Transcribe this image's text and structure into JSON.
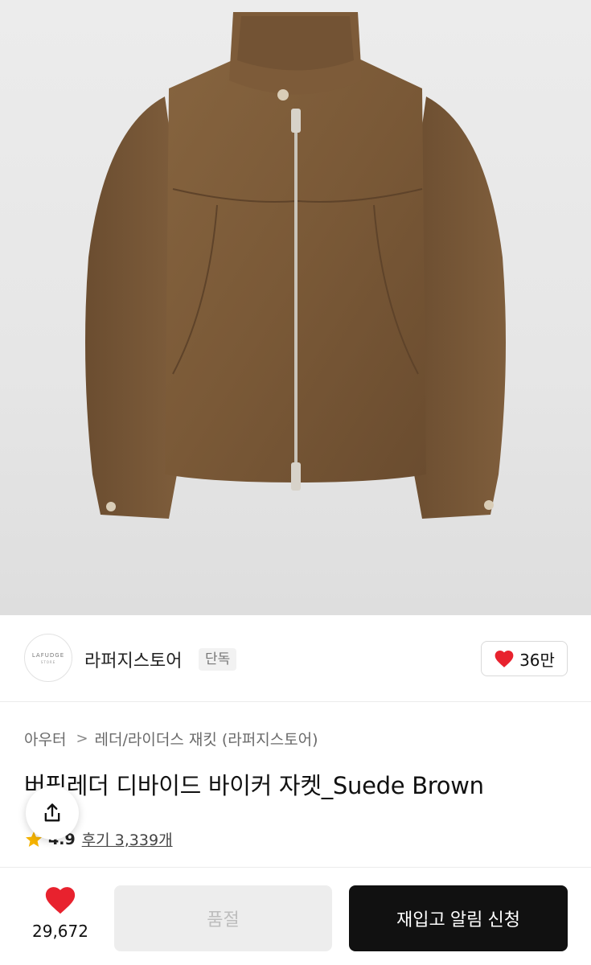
{
  "store": {
    "logo_text": "LAFUDGE",
    "logo_subtext": "STORE",
    "name": "라퍼지스토어",
    "badge": "단독",
    "like_count": "36만"
  },
  "breadcrumb": {
    "category": "아우터",
    "separator": ">",
    "subcategory": "레더/라이더스 재킷 (라퍼지스토어)"
  },
  "product": {
    "title": "버핑레더 디바이드 바이커 자켓_Suede Brown",
    "rating": "4.9",
    "reviews": "후기 3,339개"
  },
  "bottom": {
    "wish_count": "29,672",
    "soldout_label": "품절",
    "restock_label": "재입고 알림 신청"
  },
  "colors": {
    "heart": "#e8222e",
    "star": "#f5b301",
    "jacket": "#7a5a3a"
  },
  "icons": [
    "heart-icon",
    "star-icon",
    "share-icon"
  ]
}
